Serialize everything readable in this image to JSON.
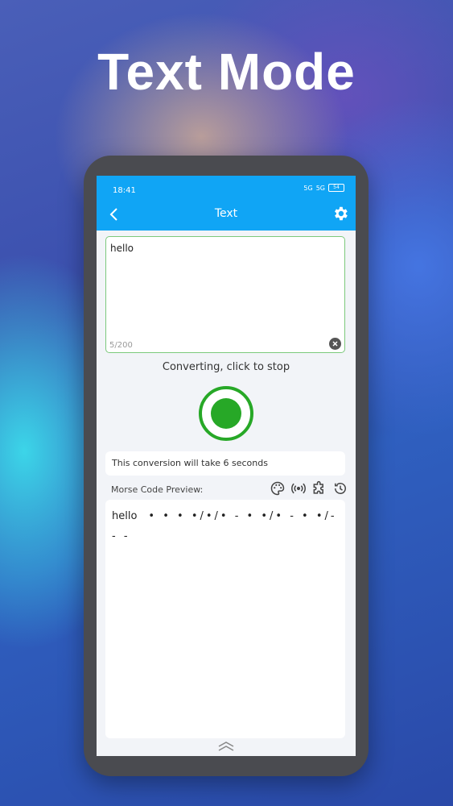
{
  "headline": "Text Mode",
  "status_bar": {
    "time": "18:41",
    "signal1": "5G",
    "signal2": "5G",
    "battery": "54"
  },
  "app_bar": {
    "title": "Text"
  },
  "input": {
    "value": "hello",
    "counter": "5/200"
  },
  "conversion": {
    "status": "Converting, click to stop",
    "duration": "This conversion will take 6 seconds"
  },
  "preview": {
    "label": "Morse Code Preview:",
    "word": "hello",
    "code": "• • • •/•/• - • •/• - • •/- - -"
  },
  "colors": {
    "accent": "#10a5f5",
    "record": "#27a827",
    "input_border": "#7cc97c"
  },
  "icons": [
    "back-arrow-icon",
    "gear-icon",
    "clear-icon",
    "palette-icon",
    "broadcast-icon",
    "puzzle-icon",
    "history-icon",
    "chevron-up-double-icon"
  ]
}
